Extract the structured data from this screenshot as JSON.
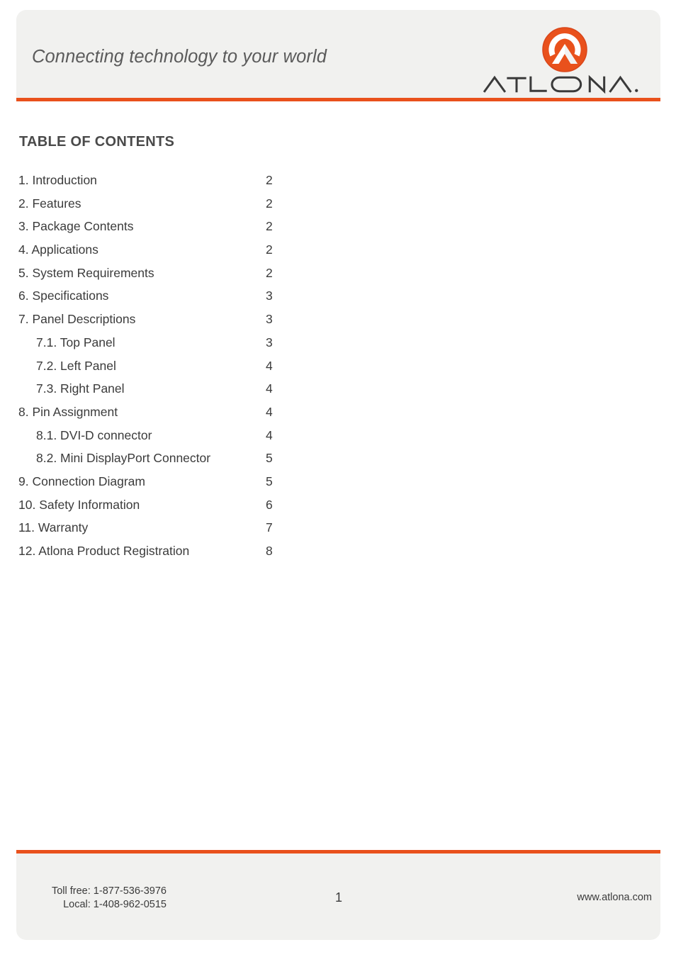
{
  "header": {
    "tagline": "Connecting technology to your world",
    "logo": {
      "mark_name": "atlona-logo-mark",
      "wordmark": "ATLONA.",
      "brand_color": "#e9511c",
      "wordmark_color": "#3a3a3a"
    },
    "rule_color": "#e9511c"
  },
  "main": {
    "title": "TABLE OF CONTENTS",
    "toc": [
      {
        "label": "1. Introduction",
        "page": "2",
        "level": 1
      },
      {
        "label": "2. Features",
        "page": "2",
        "level": 1
      },
      {
        "label": "3. Package Contents",
        "page": "2",
        "level": 1
      },
      {
        "label": "4. Applications",
        "page": "2",
        "level": 1
      },
      {
        "label": "5. System Requirements",
        "page": "2",
        "level": 1
      },
      {
        "label": "6. Specifications",
        "page": "3",
        "level": 1
      },
      {
        "label": "7. Panel Descriptions",
        "page": "3",
        "level": 1
      },
      {
        "label": "7.1. Top Panel",
        "page": "3",
        "level": 2
      },
      {
        "label": "7.2. Left Panel",
        "page": "4",
        "level": 2
      },
      {
        "label": "7.3. Right Panel",
        "page": "4",
        "level": 2
      },
      {
        "label": "8. Pin Assignment",
        "page": "4",
        "level": 1
      },
      {
        "label": "8.1. DVI-D connector",
        "page": "4",
        "level": 2
      },
      {
        "label": "8.2. Mini DisplayPort Connector",
        "page": "5",
        "level": 2
      },
      {
        "label": "9. Connection Diagram",
        "page": "5",
        "level": 1
      },
      {
        "label": "10. Safety Information",
        "page": "6",
        "level": 1
      },
      {
        "label": "11. Warranty",
        "page": "7",
        "level": 1
      },
      {
        "label": "12. Atlona Product Registration",
        "page": "8",
        "level": 1
      }
    ]
  },
  "footer": {
    "toll_free": "Toll free: 1-877-536-3976",
    "local": "Local: 1-408-962-0515",
    "page_number": "1",
    "website": "www.atlona.com",
    "rule_color": "#e9511c"
  }
}
